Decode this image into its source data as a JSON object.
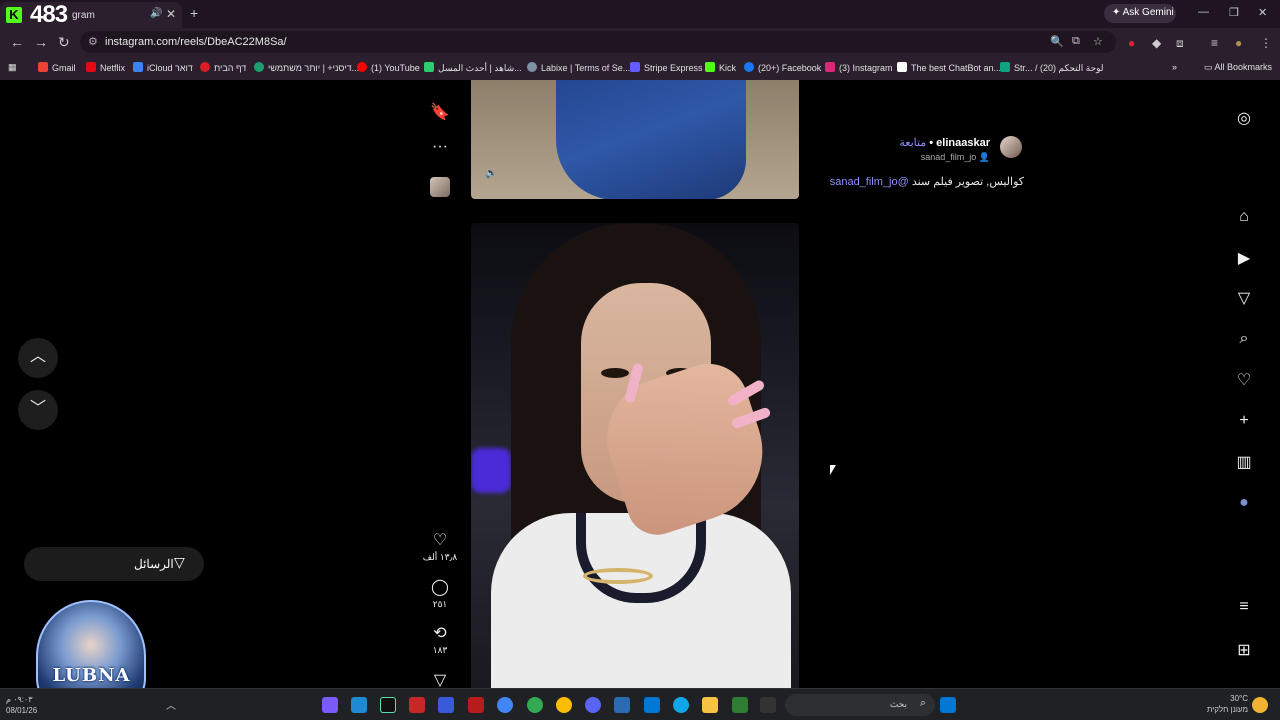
{
  "browser": {
    "tab_overlay_count": "483",
    "tab_title": "gram",
    "gemini_label": "Ask Gemini",
    "url": "instagram.com/reels/DbeAC22M8Sa/",
    "all_bookmarks": "All Bookmarks",
    "bookmarks": [
      {
        "label": "Gmail",
        "color": "#ea4335"
      },
      {
        "label": "Netflix",
        "color": "#e50914"
      },
      {
        "label": "iCloud דואר",
        "color": "#3b82f6"
      },
      {
        "label": "דף הבית",
        "color": "#d61f26"
      },
      {
        "label": "דיסני+ | יותר משתמשי...",
        "color": "#1a9f6e"
      },
      {
        "label": "(1) YouTube",
        "color": "#ff0000"
      },
      {
        "label": "شاهد | أحدث المسل...",
        "color": "#2ecc71"
      },
      {
        "label": "Labixe | Terms of Se...",
        "color": "#7f8fa6"
      },
      {
        "label": "Stripe Express",
        "color": "#635bff"
      },
      {
        "label": "Kick",
        "color": "#53fc18"
      },
      {
        "label": "(20+) Facebook",
        "color": "#1877f2"
      },
      {
        "label": "(3) Instagram",
        "color": "#d62976"
      },
      {
        "label": "The best ChatBot an...",
        "color": "#ffffff"
      },
      {
        "label": "Str... / لوحة التحكم (20)",
        "color": "#10a37f"
      }
    ]
  },
  "reel": {
    "author_name": "elinaaskar",
    "follow_label": "متابعة",
    "author_sub": "sanad_film_jo",
    "caption_text": "كواليس, تصوير فيلم سند",
    "caption_mention": "@sanad_film_jo",
    "likes": "١٣٫٨ ألف",
    "comments": "٢٥١",
    "reposts": "١٨٣"
  },
  "messages_label": "الرسائل",
  "lubna_text": "LUBNA",
  "taskbar": {
    "search_label": "بحث",
    "time": "٠٩:٠٣ م",
    "date": "08/01/26",
    "temp": "30°C",
    "weather": "מעונן חלקית"
  }
}
